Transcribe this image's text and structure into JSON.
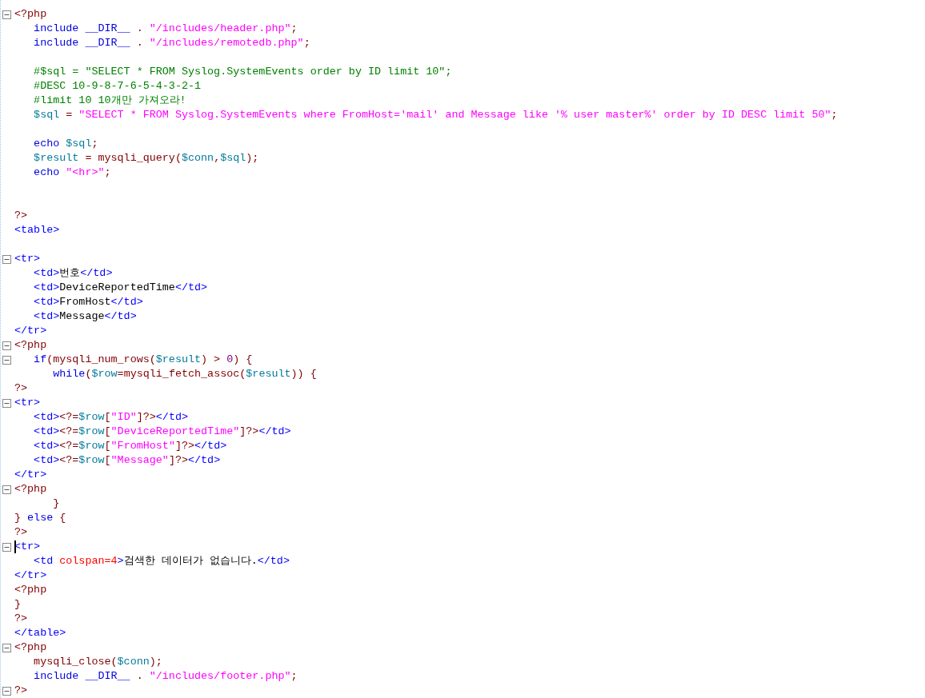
{
  "editor": {
    "lines": [
      {
        "fold": true,
        "tokens": [
          {
            "kind": "def",
            "text": "<?php"
          }
        ]
      },
      {
        "fold": false,
        "tokens": [
          {
            "kind": "kw",
            "text": "   include "
          },
          {
            "kind": "kw",
            "text": "__DIR__"
          },
          {
            "kind": "def",
            "text": " . "
          },
          {
            "kind": "str",
            "text": "\"/includes/header.php\""
          },
          {
            "kind": "def",
            "text": ";"
          }
        ]
      },
      {
        "fold": false,
        "tokens": [
          {
            "kind": "kw",
            "text": "   include "
          },
          {
            "kind": "kw",
            "text": "__DIR__"
          },
          {
            "kind": "def",
            "text": " . "
          },
          {
            "kind": "str",
            "text": "\"/includes/remotedb.php\""
          },
          {
            "kind": "def",
            "text": ";"
          }
        ]
      },
      {
        "fold": false
      },
      {
        "fold": false,
        "tokens": [
          {
            "kind": "com",
            "text": "   #$sql = \"SELECT * FROM Syslog.SystemEvents order by ID limit 10\";"
          }
        ]
      },
      {
        "fold": false,
        "tokens": [
          {
            "kind": "com",
            "text": "   #DESC 10-9-8-7-6-5-4-3-2-1"
          }
        ]
      },
      {
        "fold": false,
        "tokens": [
          {
            "kind": "com",
            "text": "   #limit 10 10개만 가져오라!"
          }
        ]
      },
      {
        "fold": false,
        "tokens": [
          {
            "kind": "var",
            "text": "   $sql"
          },
          {
            "kind": "def",
            "text": " = "
          },
          {
            "kind": "str",
            "text": "\"SELECT * FROM Syslog.SystemEvents where FromHost='mail' and Message like '% user master%' order by ID DESC limit 50\""
          },
          {
            "kind": "def",
            "text": ";"
          }
        ]
      },
      {
        "fold": false
      },
      {
        "fold": false,
        "tokens": [
          {
            "kind": "kw",
            "text": "   echo "
          },
          {
            "kind": "var",
            "text": "$sql"
          },
          {
            "kind": "def",
            "text": ";"
          }
        ]
      },
      {
        "fold": false,
        "tokens": [
          {
            "kind": "var",
            "text": "   $result"
          },
          {
            "kind": "def",
            "text": " = mysqli_query("
          },
          {
            "kind": "var",
            "text": "$conn"
          },
          {
            "kind": "def",
            "text": ","
          },
          {
            "kind": "var",
            "text": "$sql"
          },
          {
            "kind": "def",
            "text": ");"
          }
        ]
      },
      {
        "fold": false,
        "tokens": [
          {
            "kind": "kw",
            "text": "   echo "
          },
          {
            "kind": "str",
            "text": "\"<hr>\""
          },
          {
            "kind": "def",
            "text": ";"
          }
        ]
      },
      {
        "fold": false
      },
      {
        "fold": false
      },
      {
        "fold": false,
        "tokens": [
          {
            "kind": "def",
            "text": "?>"
          }
        ]
      },
      {
        "fold": false,
        "tokens": [
          {
            "kind": "tag",
            "text": "<table>"
          }
        ]
      },
      {
        "fold": false
      },
      {
        "fold": true,
        "tokens": [
          {
            "kind": "tag",
            "text": "<tr>"
          }
        ]
      },
      {
        "fold": false,
        "tokens": [
          {
            "kind": "tag",
            "text": "   <td>"
          },
          {
            "kind": "txt",
            "text": "번호"
          },
          {
            "kind": "tag",
            "text": "</td>"
          }
        ]
      },
      {
        "fold": false,
        "tokens": [
          {
            "kind": "tag",
            "text": "   <td>"
          },
          {
            "kind": "txt",
            "text": "DeviceReportedTime"
          },
          {
            "kind": "tag",
            "text": "</td>"
          }
        ]
      },
      {
        "fold": false,
        "tokens": [
          {
            "kind": "tag",
            "text": "   <td>"
          },
          {
            "kind": "txt",
            "text": "FromHost"
          },
          {
            "kind": "tag",
            "text": "</td>"
          }
        ]
      },
      {
        "fold": false,
        "tokens": [
          {
            "kind": "tag",
            "text": "   <td>"
          },
          {
            "kind": "txt",
            "text": "Message"
          },
          {
            "kind": "tag",
            "text": "</td>"
          }
        ]
      },
      {
        "fold": false,
        "tokens": [
          {
            "kind": "tag",
            "text": "</tr>"
          }
        ]
      },
      {
        "fold": true,
        "tokens": [
          {
            "kind": "def",
            "text": "<?php"
          }
        ]
      },
      {
        "fold": true,
        "tokens": [
          {
            "kind": "kw",
            "text": "   if"
          },
          {
            "kind": "def",
            "text": "(mysqli_num_rows("
          },
          {
            "kind": "var",
            "text": "$result"
          },
          {
            "kind": "def",
            "text": ") > "
          },
          {
            "kind": "num",
            "text": "0"
          },
          {
            "kind": "def",
            "text": ") {"
          }
        ]
      },
      {
        "fold": false,
        "tokens": [
          {
            "kind": "kw",
            "text": "      while"
          },
          {
            "kind": "def",
            "text": "("
          },
          {
            "kind": "var",
            "text": "$row"
          },
          {
            "kind": "def",
            "text": "=mysqli_fetch_assoc("
          },
          {
            "kind": "var",
            "text": "$result"
          },
          {
            "kind": "def",
            "text": ")) {"
          }
        ]
      },
      {
        "fold": false,
        "tokens": [
          {
            "kind": "def",
            "text": "?>"
          }
        ]
      },
      {
        "fold": true,
        "tokens": [
          {
            "kind": "tag",
            "text": "<tr>"
          }
        ]
      },
      {
        "fold": false,
        "tokens": [
          {
            "kind": "tag",
            "text": "   <td>"
          },
          {
            "kind": "def",
            "text": "<?="
          },
          {
            "kind": "var",
            "text": "$row"
          },
          {
            "kind": "def",
            "text": "["
          },
          {
            "kind": "str",
            "text": "\"ID\""
          },
          {
            "kind": "def",
            "text": "]?>"
          },
          {
            "kind": "tag",
            "text": "</td>"
          }
        ]
      },
      {
        "fold": false,
        "tokens": [
          {
            "kind": "tag",
            "text": "   <td>"
          },
          {
            "kind": "def",
            "text": "<?="
          },
          {
            "kind": "var",
            "text": "$row"
          },
          {
            "kind": "def",
            "text": "["
          },
          {
            "kind": "str",
            "text": "\"DeviceReportedTime\""
          },
          {
            "kind": "def",
            "text": "]?>"
          },
          {
            "kind": "tag",
            "text": "</td>"
          }
        ]
      },
      {
        "fold": false,
        "tokens": [
          {
            "kind": "tag",
            "text": "   <td>"
          },
          {
            "kind": "def",
            "text": "<?="
          },
          {
            "kind": "var",
            "text": "$row"
          },
          {
            "kind": "def",
            "text": "["
          },
          {
            "kind": "str",
            "text": "\"FromHost\""
          },
          {
            "kind": "def",
            "text": "]?>"
          },
          {
            "kind": "tag",
            "text": "</td>"
          }
        ]
      },
      {
        "fold": false,
        "tokens": [
          {
            "kind": "tag",
            "text": "   <td>"
          },
          {
            "kind": "def",
            "text": "<?="
          },
          {
            "kind": "var",
            "text": "$row"
          },
          {
            "kind": "def",
            "text": "["
          },
          {
            "kind": "str",
            "text": "\"Message\""
          },
          {
            "kind": "def",
            "text": "]?>"
          },
          {
            "kind": "tag",
            "text": "</td>"
          }
        ]
      },
      {
        "fold": false,
        "tokens": [
          {
            "kind": "tag",
            "text": "</tr>"
          }
        ]
      },
      {
        "fold": true,
        "tokens": [
          {
            "kind": "def",
            "text": "<?php"
          }
        ]
      },
      {
        "fold": false,
        "tokens": [
          {
            "kind": "def",
            "text": "      }"
          }
        ]
      },
      {
        "fold": false,
        "tokens": [
          {
            "kind": "def",
            "text": "} "
          },
          {
            "kind": "kw",
            "text": "else"
          },
          {
            "kind": "def",
            "text": " {"
          }
        ]
      },
      {
        "fold": false,
        "tokens": [
          {
            "kind": "def",
            "text": "?>"
          }
        ]
      },
      {
        "fold": true,
        "caret": true,
        "tokens": [
          {
            "kind": "tag",
            "text": "<tr>"
          }
        ]
      },
      {
        "fold": false,
        "tokens": [
          {
            "kind": "tag",
            "text": "   <td "
          },
          {
            "kind": "attr",
            "text": "colspan=4"
          },
          {
            "kind": "tag",
            "text": ">"
          },
          {
            "kind": "txt",
            "text": "검색한 데이터가 없습니다."
          },
          {
            "kind": "tag",
            "text": "</td>"
          }
        ]
      },
      {
        "fold": false,
        "tokens": [
          {
            "kind": "tag",
            "text": "</tr>"
          }
        ]
      },
      {
        "fold": false,
        "tokens": [
          {
            "kind": "def",
            "text": "<?php"
          }
        ]
      },
      {
        "fold": false,
        "tokens": [
          {
            "kind": "def",
            "text": "}"
          }
        ]
      },
      {
        "fold": false,
        "tokens": [
          {
            "kind": "def",
            "text": "?>"
          }
        ]
      },
      {
        "fold": false,
        "tokens": [
          {
            "kind": "tag",
            "text": "</table>"
          }
        ]
      },
      {
        "fold": true,
        "tokens": [
          {
            "kind": "def",
            "text": "<?php"
          }
        ]
      },
      {
        "fold": false,
        "tokens": [
          {
            "kind": "def",
            "text": "   mysqli_close("
          },
          {
            "kind": "var",
            "text": "$conn"
          },
          {
            "kind": "def",
            "text": ");"
          }
        ]
      },
      {
        "fold": false,
        "tokens": [
          {
            "kind": "kw",
            "text": "   include "
          },
          {
            "kind": "kw",
            "text": "__DIR__"
          },
          {
            "kind": "def",
            "text": " . "
          },
          {
            "kind": "str",
            "text": "\"/includes/footer.php\""
          },
          {
            "kind": "def",
            "text": ";"
          }
        ]
      },
      {
        "fold": true,
        "tokens": [
          {
            "kind": "def",
            "text": "?>"
          }
        ]
      }
    ]
  }
}
